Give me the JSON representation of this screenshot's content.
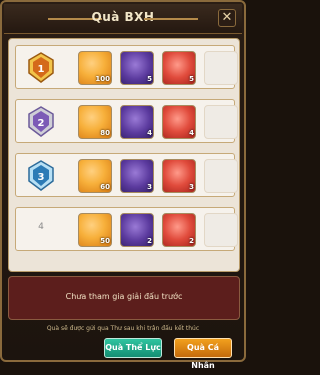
{
  "title": "Quà BXH",
  "close_icon": "close-icon",
  "rows": [
    {
      "rank": "1",
      "badge_color": "#d46a1a",
      "items": [
        {
          "name": "orange-reward",
          "count": "100"
        },
        {
          "name": "purple-reward",
          "count": "5"
        },
        {
          "name": "red-reward",
          "count": "5"
        }
      ]
    },
    {
      "rank": "2",
      "badge_color": "#7c5bb6",
      "items": [
        {
          "name": "orange-reward",
          "count": "80"
        },
        {
          "name": "purple-reward",
          "count": "4"
        },
        {
          "name": "red-reward",
          "count": "4"
        }
      ]
    },
    {
      "rank": "3",
      "badge_color": "#2c7bb6",
      "items": [
        {
          "name": "orange-reward",
          "count": "60"
        },
        {
          "name": "purple-reward",
          "count": "3"
        },
        {
          "name": "red-reward",
          "count": "3"
        }
      ]
    },
    {
      "rank": "4",
      "badge_color": "#999999",
      "items": [
        {
          "name": "orange-reward",
          "count": "50"
        },
        {
          "name": "purple-reward",
          "count": "2"
        },
        {
          "name": "red-reward",
          "count": "2"
        }
      ]
    }
  ],
  "status_text": "Chưa tham gia giải đấu trước",
  "note": "Quà sẽ được gửi qua Thư sau khi trận đấu kết thúc",
  "buttons": {
    "stamina": "Quà Thể Lực",
    "personal": "Quà Cá Nhân"
  },
  "colors": {
    "frame": "#8a6a3c",
    "status_bg": "#5c1e1c",
    "stamina_btn": "#1fa888",
    "personal_btn": "#e0891a"
  }
}
